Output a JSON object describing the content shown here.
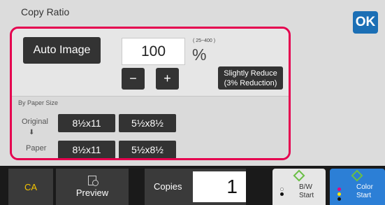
{
  "header": {
    "title": "Copy Ratio",
    "ok_label": "OK"
  },
  "ratio": {
    "auto_image_label": "Auto Image",
    "value": "100",
    "range_label": "( 25~400 )",
    "unit": "%",
    "minus_label": "−",
    "plus_label": "+",
    "slightly_reduce_line1": "Slightly Reduce",
    "slightly_reduce_line2": "(3% Reduction)"
  },
  "paper_size": {
    "section_label": "By Paper Size",
    "original_label": "Original",
    "arrow": "⬇",
    "paper_label": "Paper",
    "original_options": [
      "8½x11",
      "5½x8½"
    ],
    "paper_options": [
      "8½x11",
      "5½x8½"
    ]
  },
  "bottom": {
    "ca_label": "CA",
    "preview_label": "Preview",
    "copies_label": "Copies",
    "copies_value": "1",
    "bw_start_line1": "B/W",
    "bw_start_line2": "Start",
    "color_start_line1": "Color",
    "color_start_line2": "Start"
  },
  "colors": {
    "highlight_border": "#e5004f",
    "ok_button": "#1b6fb5",
    "ca_text": "#f4c400",
    "color_start_bg": "#2c7fd6",
    "start_diamond": "#6abf45"
  }
}
